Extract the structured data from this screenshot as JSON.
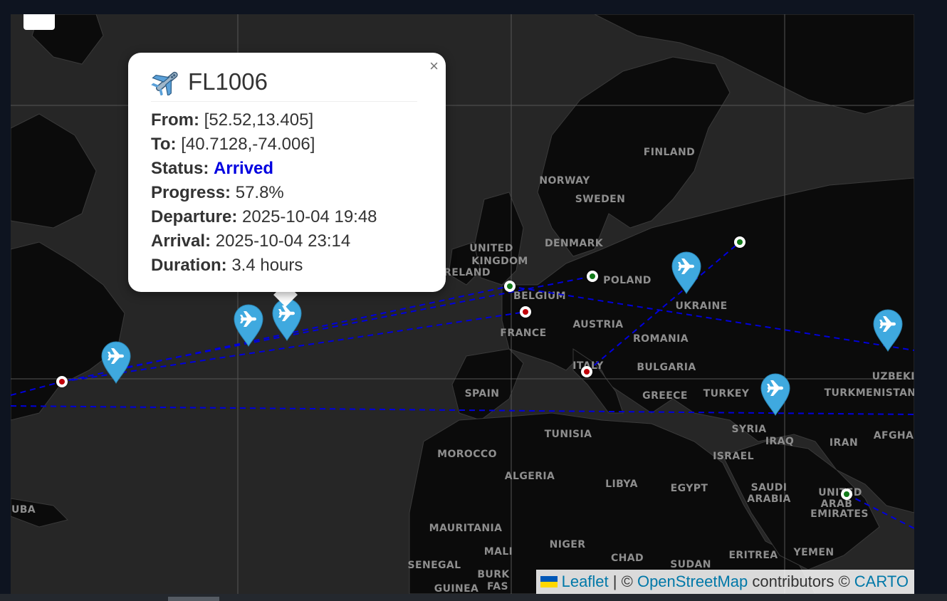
{
  "map": {
    "country_labels": [
      {
        "name": "FINLAND"
      },
      {
        "name": "NORWAY"
      },
      {
        "name": "SWEDEN"
      },
      {
        "name": "DENMARK"
      },
      {
        "name": "UNITED"
      },
      {
        "name": "KINGDOM"
      },
      {
        "name": "RELAND"
      },
      {
        "name": "BELGIUM"
      },
      {
        "name": "POLAND"
      },
      {
        "name": "BEL"
      },
      {
        "name": "UKRAINE"
      },
      {
        "name": "FRANCE"
      },
      {
        "name": "AUSTRIA"
      },
      {
        "name": "ROMANIA"
      },
      {
        "name": "ITALY"
      },
      {
        "name": "BULGARIA"
      },
      {
        "name": "SPAIN"
      },
      {
        "name": "GREECE"
      },
      {
        "name": "TURKEY"
      },
      {
        "name": "TURKMENISTAN"
      },
      {
        "name": "UZBEKIS"
      },
      {
        "name": "SYRIA"
      },
      {
        "name": "IRAQ"
      },
      {
        "name": "IRAN"
      },
      {
        "name": "AFGHA"
      },
      {
        "name": "TUNISIA"
      },
      {
        "name": "MOROCCO"
      },
      {
        "name": "ISRAEL"
      },
      {
        "name": "ALGERIA"
      },
      {
        "name": "LIBYA"
      },
      {
        "name": "EGYPT"
      },
      {
        "name": "SAUDI"
      },
      {
        "name": "ARABIA"
      },
      {
        "name": "UNITED"
      },
      {
        "name": "ARAB"
      },
      {
        "name": "EMIRATES"
      },
      {
        "name": "UBA"
      },
      {
        "name": "MAURITANIA"
      },
      {
        "name": "MALI"
      },
      {
        "name": "NIGER"
      },
      {
        "name": "CHAD"
      },
      {
        "name": "SUDAN"
      },
      {
        "name": "ERITREA"
      },
      {
        "name": "YEMEN"
      },
      {
        "name": "SENEGAL"
      },
      {
        "name": "BURK"
      },
      {
        "name": "FAS"
      },
      {
        "name": "GUINEA"
      }
    ],
    "route_color": "#0000dd",
    "marker_color": "#3fa9df",
    "origin_dot_color": "#c0000a",
    "destination_dot_color": "#137a1a"
  },
  "popup": {
    "close": "×",
    "flight_id": "FL1006",
    "from_label": "From:",
    "from_value": "[52.52,13.405]",
    "to_label": "To:",
    "to_value": "[40.7128,-74.006]",
    "status_label": "Status:",
    "status_value": "Arrived",
    "progress_label": "Progress:",
    "progress_value": "57.8%",
    "departure_label": "Departure:",
    "departure_value": "2025-10-04 19:48",
    "arrival_label": "Arrival:",
    "arrival_value": "2025-10-04 23:14",
    "duration_label": "Duration:",
    "duration_value": "3.4 hours"
  },
  "attribution": {
    "leaflet": "Leaflet",
    "sep": "| ©",
    "osm": "OpenStreetMap",
    "contributors": "contributors ©",
    "carto": "CARTO"
  }
}
